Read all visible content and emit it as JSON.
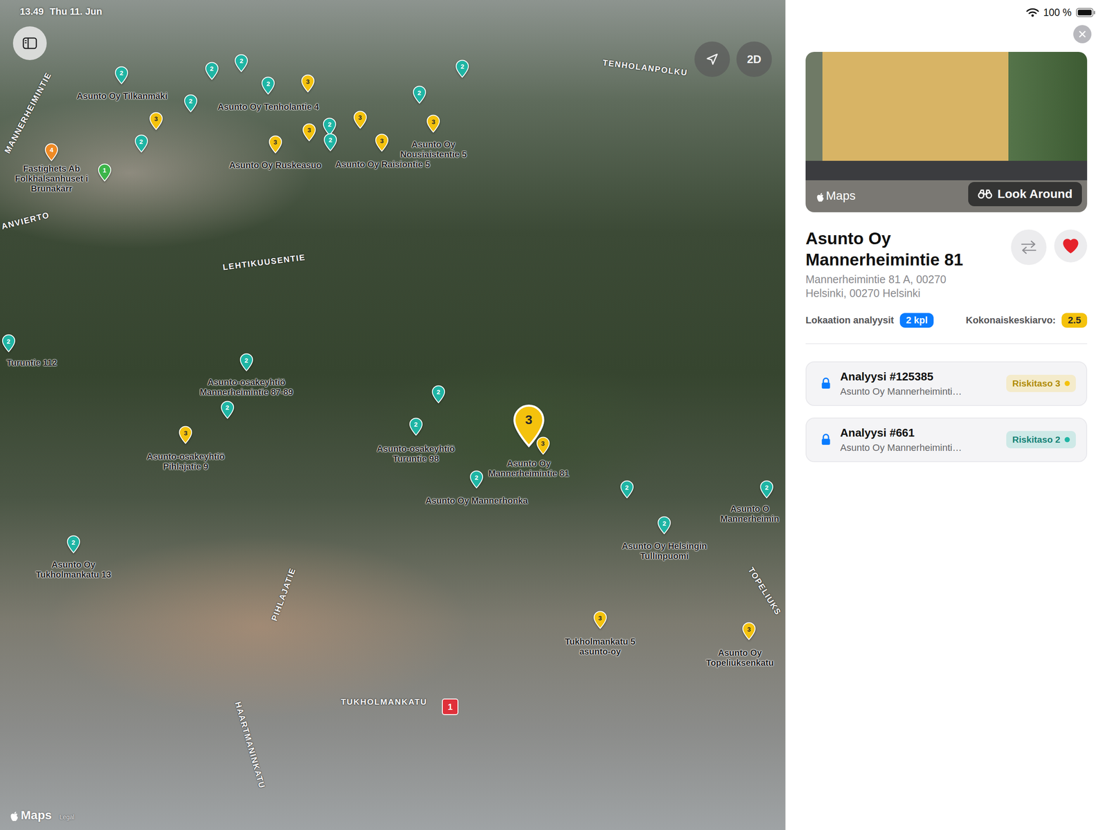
{
  "status_bar": {
    "time": "13.49",
    "date": "Thu 11. Jun",
    "battery": "100 %"
  },
  "map": {
    "view_toggle": "2D",
    "logo": "Maps",
    "legal": "Legal",
    "route_badge": "1",
    "streets": [
      {
        "label": "MANNERHEIMINTIE"
      },
      {
        "label": "ANVIERTO"
      },
      {
        "label": "TENHOLANPOLKU"
      },
      {
        "label": "LEHTIKUUSENTIE"
      },
      {
        "label": "PIHLAJATIE"
      },
      {
        "label": "TUKHOLMANKATU"
      },
      {
        "label": "HAARTMANINKATU"
      },
      {
        "label": "TOPELIUKS"
      }
    ],
    "places": [
      {
        "label": "Asunto Oy Tilkanmäki"
      },
      {
        "label": "Asunto Oy Tenholantie 4"
      },
      {
        "label": "Fastighets Ab Folkhälsanhuset i Brunakärr"
      },
      {
        "label": "Asunto Oy Ruskeasuo"
      },
      {
        "label": "Asunto Oy Raisiontie 5"
      },
      {
        "label": "Asunto Oy Nousiaistentie 5"
      },
      {
        "label": "Turuntie 112"
      },
      {
        "label": "Asunto-osakeyhtiö Mannerheimintie 87-89"
      },
      {
        "label": "Asunto-osakeyhtiö Pihlajatie 9"
      },
      {
        "label": "Asunto-osakeyhtiö Turuntie 98"
      },
      {
        "label": "Asunto Oy Mannerheimintie 81"
      },
      {
        "label": "Asunto Oy Mannerhonka"
      },
      {
        "label": "Asunto Oy Helsingin Tullinpuomi"
      },
      {
        "label": "Asunto O Mannerheimin"
      },
      {
        "label": "Asunto Oy Tukholmankatu 13"
      },
      {
        "label": "Tukholmankatu 5 asunto-oy"
      },
      {
        "label": "Asunto Oy Topeliuksenkatu"
      }
    ],
    "pins": [
      {
        "number": "2",
        "color": "#1fb5a4",
        "selected": false
      },
      {
        "number": "2",
        "color": "#1fb5a4",
        "selected": false
      },
      {
        "number": "2",
        "color": "#1fb5a4",
        "selected": false
      },
      {
        "number": "2",
        "color": "#1fb5a4",
        "selected": false
      },
      {
        "number": "2",
        "color": "#1fb5a4",
        "selected": false
      },
      {
        "number": "2",
        "color": "#1fb5a4",
        "selected": false
      },
      {
        "number": "2",
        "color": "#1fb5a4",
        "selected": false
      },
      {
        "number": "2",
        "color": "#1fb5a4",
        "selected": false
      },
      {
        "number": "2",
        "color": "#1fb5a4",
        "selected": false
      },
      {
        "number": "2",
        "color": "#1fb5a4",
        "selected": false
      },
      {
        "number": "2",
        "color": "#1fb5a4",
        "selected": false
      },
      {
        "number": "2",
        "color": "#1fb5a4",
        "selected": false
      },
      {
        "number": "2",
        "color": "#1fb5a4",
        "selected": false
      },
      {
        "number": "2",
        "color": "#1fb5a4",
        "selected": false
      },
      {
        "number": "2",
        "color": "#1fb5a4",
        "selected": false
      },
      {
        "number": "2",
        "color": "#1fb5a4",
        "selected": false
      },
      {
        "number": "2",
        "color": "#1fb5a4",
        "selected": false
      },
      {
        "number": "2",
        "color": "#1fb5a4",
        "selected": false
      },
      {
        "number": "2",
        "color": "#1fb5a4",
        "selected": false
      },
      {
        "number": "2",
        "color": "#1fb5a4",
        "selected": false
      },
      {
        "number": "3",
        "color": "#f4c20d",
        "selected": false
      },
      {
        "number": "3",
        "color": "#f4c20d",
        "selected": false
      },
      {
        "number": "3",
        "color": "#f4c20d",
        "selected": false
      },
      {
        "number": "3",
        "color": "#f4c20d",
        "selected": false
      },
      {
        "number": "3",
        "color": "#f4c20d",
        "selected": false
      },
      {
        "number": "3",
        "color": "#f4c20d",
        "selected": false
      },
      {
        "number": "3",
        "color": "#f4c20d",
        "selected": false
      },
      {
        "number": "3",
        "color": "#f4c20d",
        "selected": false
      },
      {
        "number": "3",
        "color": "#f4c20d",
        "selected": false
      },
      {
        "number": "3",
        "color": "#f4c20d",
        "selected": false
      },
      {
        "number": "3",
        "color": "#f4c20d",
        "selected": false
      },
      {
        "number": "4",
        "color": "#f08a24",
        "selected": false
      },
      {
        "number": "1",
        "color": "#3cb54a",
        "selected": false
      },
      {
        "number": "3",
        "color": "#f4c20d",
        "selected": true
      }
    ]
  },
  "panel": {
    "photo": {
      "logo": "Maps",
      "action": "Look Around"
    },
    "title": "Asunto Oy Mannerheimintie 81",
    "address": [
      "Mannerheimintie 81 A, 00270",
      "Helsinki, 00270 Helsinki"
    ],
    "favorite": true,
    "analyses_label": "Lokaation analyysit",
    "analyses_count": "2 kpl",
    "average_label": "Kokonaiskeskiarvo:",
    "average": "2.5",
    "analyses": [
      {
        "title": "Analyysi #125385",
        "subtitle": "Asunto Oy Mannerheiminti…",
        "risk": "Riskitaso 3",
        "color": "#f4c20d",
        "locked": true
      },
      {
        "title": "Analyysi #661",
        "subtitle": "Asunto Oy Mannerheiminti…",
        "risk": "Riskitaso 2",
        "color": "#1fb5a4",
        "locked": true
      }
    ]
  }
}
